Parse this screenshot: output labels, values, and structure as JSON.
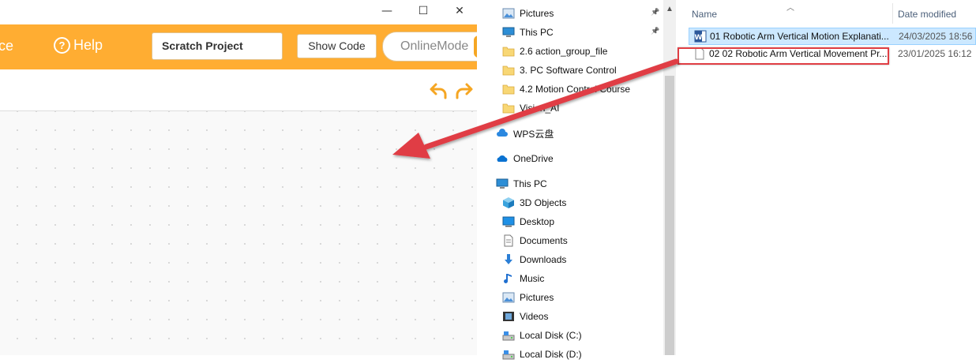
{
  "app": {
    "menu_partial": "ce",
    "help_label": "Help",
    "help_icon_glyph": "?",
    "project_name": "Scratch Project",
    "show_code_label": "Show Code",
    "online_mode_label": "OnlineMode",
    "window_controls": {
      "minimize": "—",
      "maximize": "☐",
      "close": "✕"
    },
    "accent_color": "#ffad32"
  },
  "explorer": {
    "nav_items": [
      {
        "label": "Pictures",
        "icon": "pictures-icon",
        "pinned": true
      },
      {
        "label": "This PC",
        "icon": "this-pc-icon",
        "pinned": true
      },
      {
        "label": "2.6 action_group_file",
        "icon": "folder-icon"
      },
      {
        "label": "3. PC Software Control",
        "icon": "folder-icon"
      },
      {
        "label": "4.2 Motion Control Course",
        "icon": "folder-icon"
      },
      {
        "label": "Vision_AI",
        "icon": "folder-icon"
      },
      {
        "label": "WPS云盘",
        "icon": "cloud-icon"
      },
      {
        "label": "OneDrive",
        "icon": "onedrive-icon"
      },
      {
        "label": "This PC",
        "icon": "this-pc-icon"
      },
      {
        "label": "3D Objects",
        "icon": "3d-objects-icon"
      },
      {
        "label": "Desktop",
        "icon": "desktop-icon"
      },
      {
        "label": "Documents",
        "icon": "documents-icon"
      },
      {
        "label": "Downloads",
        "icon": "downloads-icon"
      },
      {
        "label": "Music",
        "icon": "music-icon"
      },
      {
        "label": "Pictures",
        "icon": "pictures-icon"
      },
      {
        "label": "Videos",
        "icon": "videos-icon"
      },
      {
        "label": "Local Disk (C:)",
        "icon": "disk-icon"
      },
      {
        "label": "Local Disk (D:)",
        "icon": "disk-icon"
      }
    ],
    "columns": {
      "name": "Name",
      "date_modified": "Date modified"
    },
    "files": [
      {
        "name": "01 Robotic Arm Vertical Motion Explanati...",
        "date": "24/03/2025 18:56",
        "icon": "word-document-icon",
        "selected": true
      },
      {
        "name": "02 02 Robotic Arm Vertical Movement Pr...",
        "date": "23/01/2025 16:12",
        "icon": "blank-file-icon",
        "highlighted": true
      }
    ],
    "annotation_color": "#e03e44"
  }
}
